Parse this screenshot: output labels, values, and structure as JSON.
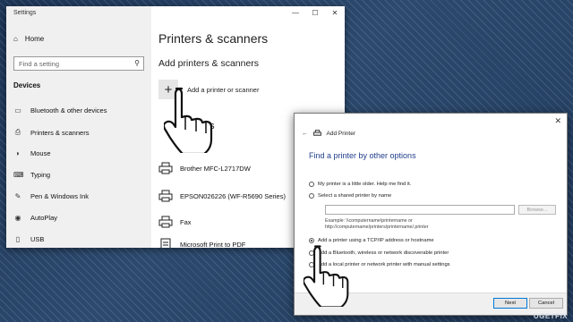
{
  "settings": {
    "window_title": "Settings",
    "controls": {
      "minimize": "—",
      "maximize": "☐",
      "close": "✕"
    },
    "sidebar": {
      "home": "Home",
      "search_placeholder": "Find a setting",
      "section": "Devices",
      "items": [
        {
          "label": "Bluetooth & other devices",
          "icon": "bluetooth-icon"
        },
        {
          "label": "Printers & scanners",
          "icon": "printer-icon"
        },
        {
          "label": "Mouse",
          "icon": "mouse-icon"
        },
        {
          "label": "Typing",
          "icon": "keyboard-icon"
        },
        {
          "label": "Pen & Windows Ink",
          "icon": "pen-icon"
        },
        {
          "label": "AutoPlay",
          "icon": "autoplay-icon"
        },
        {
          "label": "USB",
          "icon": "usb-icon"
        }
      ]
    },
    "main": {
      "title": "Printers & scanners",
      "add_heading": "Add printers & scanners",
      "add_label": "Add a printer or scanner",
      "printers_heading": "scanners",
      "printers": [
        "Brother MFC-L2717DW",
        "EPSON026226 (WF-R5690 Series)",
        "Fax",
        "Microsoft Print to PDF"
      ]
    }
  },
  "dialog": {
    "close": "✕",
    "back": "←",
    "title": "Add Printer",
    "heading": "Find a printer by other options",
    "options": [
      {
        "label": "My printer is a little older. Help me find it.",
        "selected": false
      },
      {
        "label": "Select a shared printer by name",
        "selected": false
      },
      {
        "label": "Add a printer using a TCP/IP address or hostname",
        "selected": true
      },
      {
        "label": "Add a Bluetooth, wireless or network discoverable printer",
        "selected": false
      },
      {
        "label": "Add a local printer or network printer with manual settings",
        "selected": false
      }
    ],
    "browse_label": "Browse...",
    "example_line1": "Example: \\\\computername\\printername or",
    "example_line2": "http://computername/printers/printername/.printer",
    "next_label": "Next",
    "cancel_label": "Cancel"
  },
  "watermark": "UGETFIX"
}
